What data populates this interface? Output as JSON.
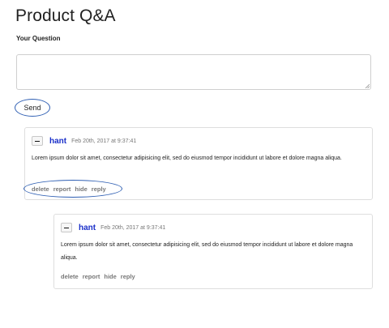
{
  "page": {
    "title": "Product Q&A",
    "question_label": "Your Question",
    "question_value": "",
    "send_label": "Send"
  },
  "colors": {
    "author": "#1a2fc9",
    "annotation_outline": "#2f5fb3",
    "muted": "#777777",
    "border": "#dedede"
  },
  "icons": {
    "collapse": "minus-icon"
  },
  "comments": [
    {
      "author": "hant",
      "timestamp": "Feb 20th, 2017 at 9:37:41",
      "body": "Lorem ipsum dolor sit amet, consectetur adipisicing elit, sed do eiusmod tempor incididunt ut labore et dolore magna aliqua.",
      "actions": [
        "delete",
        "report",
        "hide",
        "reply"
      ]
    },
    {
      "author": "hant",
      "timestamp": "Feb 20th, 2017 at 9:37:41",
      "body": "Lorem ipsum dolor sit amet, consectetur adipisicing elit, sed do eiusmod tempor incididunt ut labore et dolore magna aliqua.",
      "actions": [
        "delete",
        "report",
        "hide",
        "reply"
      ]
    }
  ]
}
